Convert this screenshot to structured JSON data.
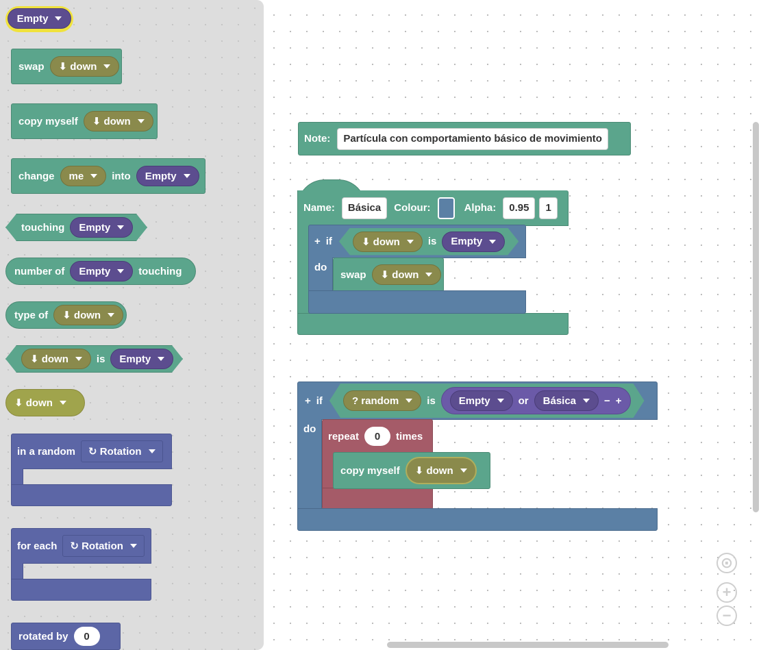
{
  "toolbox": {
    "empty_chip": "Empty",
    "swap_block": {
      "label": "swap",
      "dir": "⬇ down"
    },
    "copy_block": {
      "label": "copy myself",
      "dir": "⬇ down"
    },
    "change_block": {
      "label": "change",
      "who": "me",
      "into": "into",
      "target": "Empty"
    },
    "touching_block": {
      "label": "touching",
      "target": "Empty"
    },
    "numberof_block": {
      "label": "number of",
      "target": "Empty",
      "suffix": "touching"
    },
    "typeof_block": {
      "label": "type of",
      "dir": "⬇ down"
    },
    "is_block": {
      "dir": "⬇ down",
      "is": "is",
      "target": "Empty"
    },
    "dir_block": {
      "dir": "⬇ down"
    },
    "random_block": {
      "label": "in a random",
      "option": "↻ Rotation"
    },
    "foreach_block": {
      "label": "for each",
      "option": "↻ Rotation"
    },
    "rotated_block": {
      "label": "rotated by",
      "value": "0"
    }
  },
  "workspace": {
    "note": {
      "label": "Note:",
      "text": "Partícula con comportamiento básico de movimiento"
    },
    "element": {
      "name_label": "Name:",
      "name_value": "Básica",
      "colour_label": "Colour:",
      "colour_value": "#5b80a5",
      "alpha_label": "Alpha:",
      "alpha_value": "0.95",
      "extra_value": "1",
      "if_plus": "+",
      "if_label": "if",
      "if_dir": "⬇ down",
      "if_is": "is",
      "if_target": "Empty",
      "do_label": "do",
      "swap_label": "swap",
      "swap_dir": "⬇ down"
    },
    "rule2": {
      "if_plus": "+",
      "if_label": "if",
      "random": "? random",
      "is": "is",
      "opt1": "Empty",
      "or": "or",
      "opt2": "Básica",
      "minus": "−",
      "plus": "+",
      "do_label": "do",
      "repeat_label": "repeat",
      "repeat_value": "0",
      "times_label": "times",
      "copy_label": "copy myself",
      "copy_dir": "⬇ down"
    }
  },
  "zoom": {
    "center": "⊙",
    "zoom_in": "+",
    "zoom_out": "−"
  }
}
